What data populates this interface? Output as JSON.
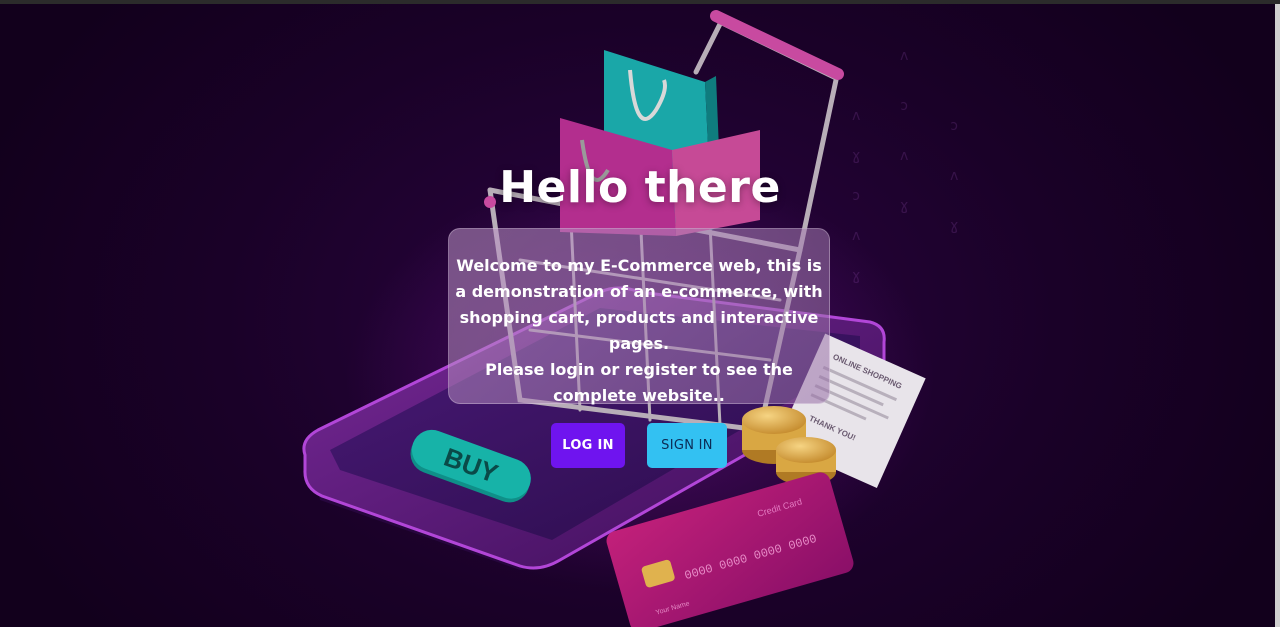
{
  "hero": {
    "title": "Hello there",
    "intro_lines": [
      "Welcome to my E-Commerce web, this is a demonstration of an e-commerce, with shopping cart, products and interactive pages.",
      "Please login or register to see the complete website.."
    ],
    "illustration": {
      "phone_button_label": "BUY",
      "receipt_title": "ONLINE SHOPPING",
      "receipt_footer": "THANK YOU!",
      "card_title": "Credit Card",
      "card_number": "0000 0000 0000 0000",
      "card_holder": "Your Name"
    }
  },
  "actions": {
    "login_label": "LOG IN",
    "signin_label": "SIGN IN"
  },
  "colors": {
    "background": "#1a0128",
    "login_button": "#6f14ef",
    "signin_button": "#33c1f2"
  }
}
